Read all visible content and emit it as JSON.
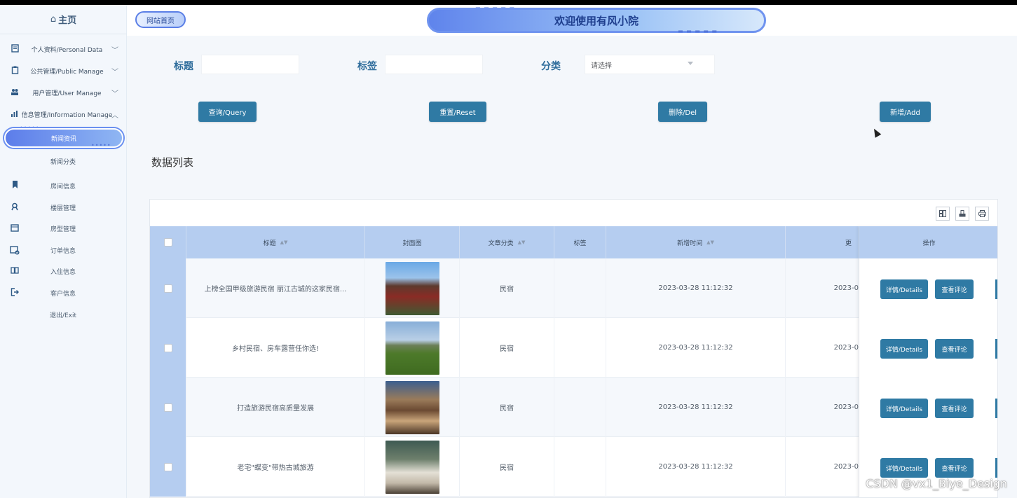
{
  "sidebar": {
    "home": "主页",
    "menus": [
      {
        "label": "个人资料/Personal Data",
        "icon": "document-icon"
      },
      {
        "label": "公共管理/Public Manage",
        "icon": "clipboard-icon"
      },
      {
        "label": "用户管理/User Manage",
        "icon": "users-icon"
      },
      {
        "label": "信息管理/Information Manage",
        "icon": "chart-icon"
      }
    ],
    "active_item": "新闻资讯",
    "items": [
      {
        "label": "新闻分类",
        "icon": ""
      },
      {
        "label": "房间信息",
        "icon": "bookmark-icon"
      },
      {
        "label": "楼层管理",
        "icon": "user-badge-icon"
      },
      {
        "label": "房型管理",
        "icon": "calendar-icon"
      },
      {
        "label": "订单信息",
        "icon": "calendar-check-icon"
      },
      {
        "label": "入住信息",
        "icon": "book-icon"
      },
      {
        "label": "客户信息",
        "icon": "exit-icon"
      },
      {
        "label": "退出/Exit",
        "icon": ""
      }
    ]
  },
  "header": {
    "site_home": "网站首页",
    "welcome": "欢迎使用有风小院"
  },
  "filters": {
    "title_label": "标题",
    "tag_label": "标签",
    "category_label": "分类",
    "category_placeholder": "请选择"
  },
  "buttons": {
    "query": "查询/Query",
    "reset": "重置/Reset",
    "delete": "删除/Del",
    "add": "新增/Add"
  },
  "list_title": "数据列表",
  "table": {
    "columns": [
      "标题",
      "封面图",
      "文章分类",
      "标签",
      "新增时间",
      "更",
      "操作"
    ],
    "rows": [
      {
        "title": "上榜全国甲级旅游民宿 丽江古城的这家民宿...",
        "category": "民宿",
        "tag": "",
        "created": "2023-03-28 11:12:32",
        "updated": "2023-0"
      },
      {
        "title": "乡村民宿、房车露营任你选!",
        "category": "民宿",
        "tag": "",
        "created": "2023-03-28 11:12:32",
        "updated": "2023-0"
      },
      {
        "title": "打造旅游民宿高质量发展",
        "category": "民宿",
        "tag": "",
        "created": "2023-03-28 11:12:32",
        "updated": "2023-0"
      },
      {
        "title": "老宅\"蝶变\"带热古城旅游",
        "category": "民宿",
        "tag": "",
        "created": "2023-03-28 11:12:32",
        "updated": "2023-0"
      }
    ],
    "details_label": "详情/Details",
    "comments_label": "查看评论"
  },
  "watermark": "CSDN @vx1_Biye_Design",
  "colors": {
    "primary_button": "#2f7aa4",
    "header_row": "#b5cdf0",
    "accent": "#5c7dea"
  }
}
